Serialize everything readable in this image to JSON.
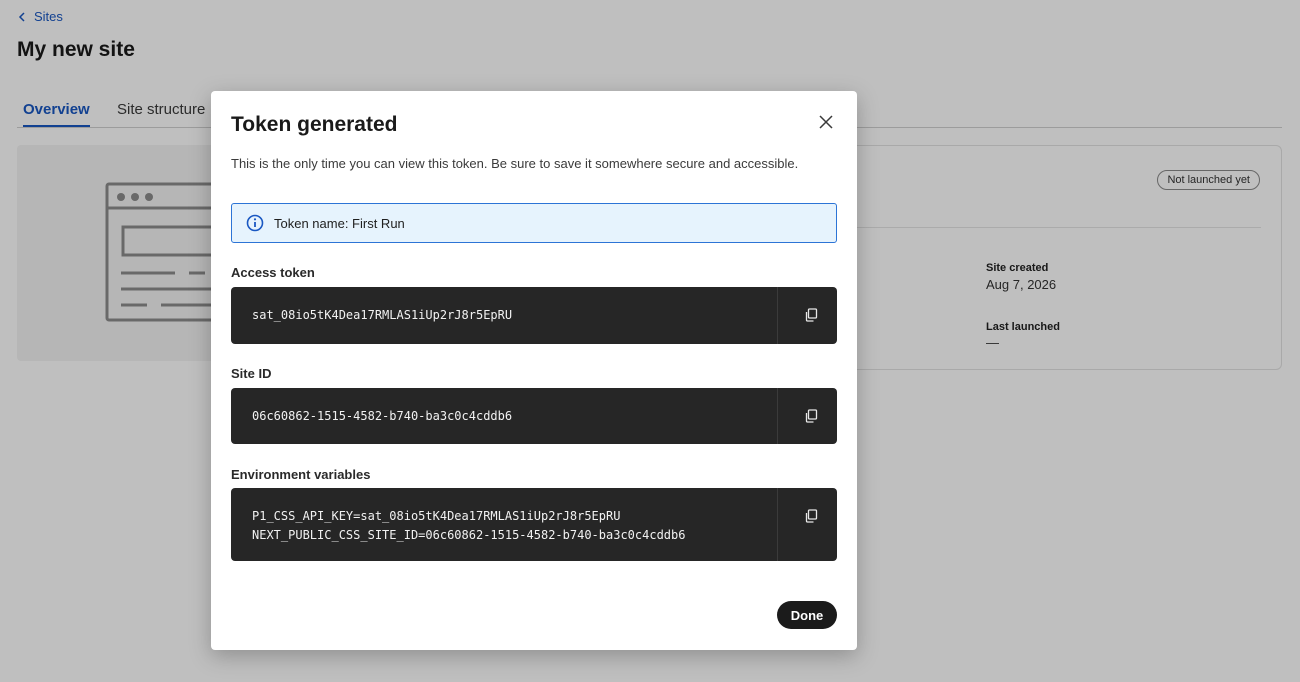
{
  "page": {
    "back_label": "Sites",
    "title": "My new site",
    "tabs": [
      {
        "label": "Overview",
        "active": true
      },
      {
        "label": "Site structure",
        "active": false
      }
    ],
    "status_badge": "Not launched yet",
    "meta": {
      "site_created_label": "Site created",
      "site_created_value": "Aug 7, 2026",
      "last_launched_label": "Last launched",
      "last_launched_value": "—"
    }
  },
  "modal": {
    "title": "Token generated",
    "description": "This is the only time you can view this token. Be sure to save it somewhere secure and accessible.",
    "info": "Token name: First Run",
    "access_token": {
      "label": "Access token",
      "value": "sat_08io5tK4Dea17RMLAS1iUp2rJ8r5EpRU"
    },
    "site_id": {
      "label": "Site ID",
      "value": "06c60862-1515-4582-b740-ba3c0c4cddb6"
    },
    "env_vars": {
      "label": "Environment variables",
      "line1": "P1_CSS_API_KEY=sat_08io5tK4Dea17RMLAS1iUp2rJ8r5EpRU",
      "line2": "NEXT_PUBLIC_CSS_SITE_ID=06c60862-1515-4582-b740-ba3c0c4cddb6"
    },
    "done_label": "Done"
  },
  "colors": {
    "accent": "#1957c2",
    "info_bg": "#e6f3fd",
    "info_border": "#2c74d6",
    "code_bg": "#262626",
    "overlay": "rgba(0,0,0,0.25)"
  },
  "icons": {
    "back": "chevron-left-icon",
    "close": "close-icon",
    "info": "info-icon",
    "copy": "copy-icon",
    "preview": "browser-window-icon"
  }
}
